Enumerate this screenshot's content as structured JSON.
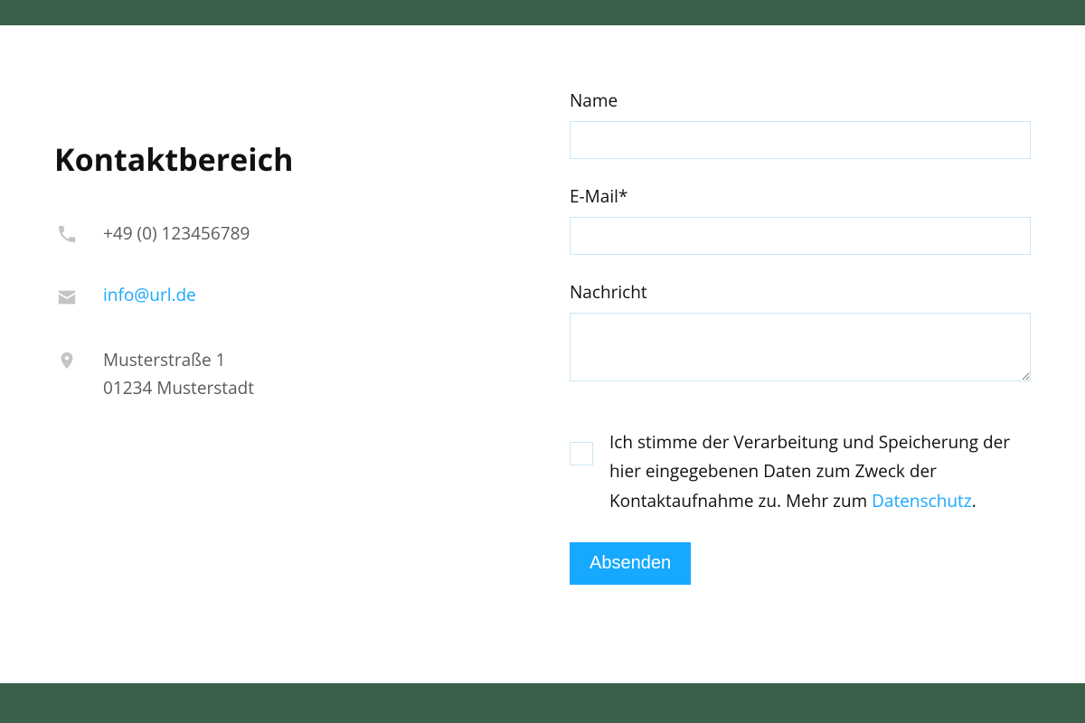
{
  "title": "Kontaktbereich",
  "contact": {
    "phone": "+49 (0) 123456789",
    "email": "info@url.de",
    "address_line1": "Musterstraße 1",
    "address_line2": "01234 Musterstadt"
  },
  "form": {
    "name_label": "Name",
    "email_label": "E-Mail*",
    "message_label": "Nachricht",
    "consent_prefix": "Ich stimme der Verarbeitung und Speicherung der hier eingegebenen Daten zum Zweck der Kontaktaufnahme zu. Mehr zum ",
    "consent_link": "Datenschutz",
    "consent_suffix": ".",
    "submit_label": "Absenden"
  }
}
